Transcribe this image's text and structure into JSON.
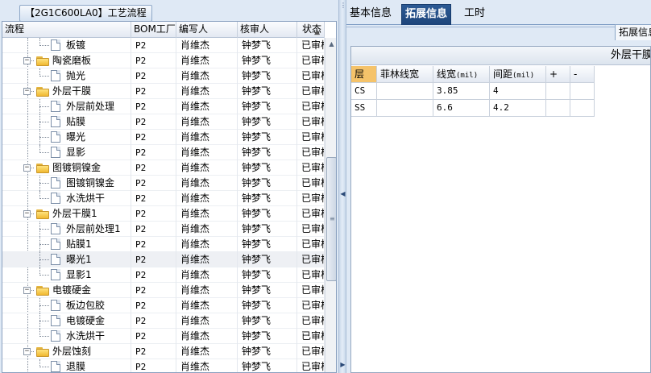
{
  "left_panel": {
    "title": "【2G1C600LA0】工艺流程",
    "columns": [
      "流程",
      "BOM工厂",
      "编写人",
      "核审人",
      "状态"
    ],
    "rows": [
      {
        "level": 2,
        "type": "doc",
        "name": "板镀",
        "bom": "P2",
        "writer": "肖维杰",
        "reviewer": "钟梦飞",
        "status": "已审核"
      },
      {
        "level": 1,
        "type": "folder",
        "name": "陶瓷磨板",
        "bom": "P2",
        "writer": "肖维杰",
        "reviewer": "钟梦飞",
        "status": "已审核"
      },
      {
        "level": 2,
        "type": "doc",
        "name": "抛光",
        "bom": "P2",
        "writer": "肖维杰",
        "reviewer": "钟梦飞",
        "status": "已审核"
      },
      {
        "level": 1,
        "type": "folder",
        "name": "外层干膜",
        "bom": "P2",
        "writer": "肖维杰",
        "reviewer": "钟梦飞",
        "status": "已审核"
      },
      {
        "level": 2,
        "type": "doc",
        "name": "外层前处理",
        "bom": "P2",
        "writer": "肖维杰",
        "reviewer": "钟梦飞",
        "status": "已审核"
      },
      {
        "level": 2,
        "type": "doc",
        "name": "贴膜",
        "bom": "P2",
        "writer": "肖维杰",
        "reviewer": "钟梦飞",
        "status": "已审核"
      },
      {
        "level": 2,
        "type": "doc",
        "name": "曝光",
        "bom": "P2",
        "writer": "肖维杰",
        "reviewer": "钟梦飞",
        "status": "已审核"
      },
      {
        "level": 2,
        "type": "doc",
        "name": "显影",
        "bom": "P2",
        "writer": "肖维杰",
        "reviewer": "钟梦飞",
        "status": "已审核"
      },
      {
        "level": 1,
        "type": "folder",
        "name": "图镀铜镍金",
        "bom": "P2",
        "writer": "肖维杰",
        "reviewer": "钟梦飞",
        "status": "已审核"
      },
      {
        "level": 2,
        "type": "doc",
        "name": "图镀铜镍金",
        "bom": "P2",
        "writer": "肖维杰",
        "reviewer": "钟梦飞",
        "status": "已审核"
      },
      {
        "level": 2,
        "type": "doc",
        "name": "水洗烘干",
        "bom": "P2",
        "writer": "肖维杰",
        "reviewer": "钟梦飞",
        "status": "已审核"
      },
      {
        "level": 1,
        "type": "folder",
        "name": "外层干膜1",
        "bom": "P2",
        "writer": "肖维杰",
        "reviewer": "钟梦飞",
        "status": "已审核"
      },
      {
        "level": 2,
        "type": "doc",
        "name": "外层前处理1",
        "bom": "P2",
        "writer": "肖维杰",
        "reviewer": "钟梦飞",
        "status": "已审核"
      },
      {
        "level": 2,
        "type": "doc",
        "name": "贴膜1",
        "bom": "P2",
        "writer": "肖维杰",
        "reviewer": "钟梦飞",
        "status": "已审核"
      },
      {
        "level": 2,
        "type": "doc",
        "name": "曝光1",
        "bom": "P2",
        "writer": "肖维杰",
        "reviewer": "钟梦飞",
        "status": "已审核",
        "selected": true
      },
      {
        "level": 2,
        "type": "doc",
        "name": "显影1",
        "bom": "P2",
        "writer": "肖维杰",
        "reviewer": "钟梦飞",
        "status": "已审核"
      },
      {
        "level": 1,
        "type": "folder",
        "name": "电镀硬金",
        "bom": "P2",
        "writer": "肖维杰",
        "reviewer": "钟梦飞",
        "status": "已审核"
      },
      {
        "level": 2,
        "type": "doc",
        "name": "板边包胶",
        "bom": "P2",
        "writer": "肖维杰",
        "reviewer": "钟梦飞",
        "status": "已审核"
      },
      {
        "level": 2,
        "type": "doc",
        "name": "电镀硬金",
        "bom": "P2",
        "writer": "肖维杰",
        "reviewer": "钟梦飞",
        "status": "已审核"
      },
      {
        "level": 2,
        "type": "doc",
        "name": "水洗烘干",
        "bom": "P2",
        "writer": "肖维杰",
        "reviewer": "钟梦飞",
        "status": "已审核"
      },
      {
        "level": 1,
        "type": "folder",
        "name": "外层蚀刻",
        "bom": "P2",
        "writer": "肖维杰",
        "reviewer": "钟梦飞",
        "status": "已审核"
      },
      {
        "level": 2,
        "type": "doc",
        "name": "退膜",
        "bom": "P2",
        "writer": "肖维杰",
        "reviewer": "钟梦飞",
        "status": "已审核"
      }
    ]
  },
  "right_panel": {
    "tabs": [
      {
        "label": "基本信息",
        "active": false
      },
      {
        "label": "拓展信息",
        "active": true
      },
      {
        "label": "工时",
        "active": false
      }
    ],
    "subtab_label": "拓展信息",
    "content_title": "外层干膜",
    "table": {
      "headers": [
        "层",
        "菲林线宽",
        "线宽",
        "间距",
        "+",
        "-"
      ],
      "header_units": [
        "",
        "",
        "(mil)",
        "(mil)",
        "",
        ""
      ],
      "rows": [
        [
          "CS",
          "",
          "3.85",
          "4",
          "",
          ""
        ],
        [
          "SS",
          "",
          "6.6",
          "4.2",
          "",
          ""
        ]
      ]
    }
  }
}
